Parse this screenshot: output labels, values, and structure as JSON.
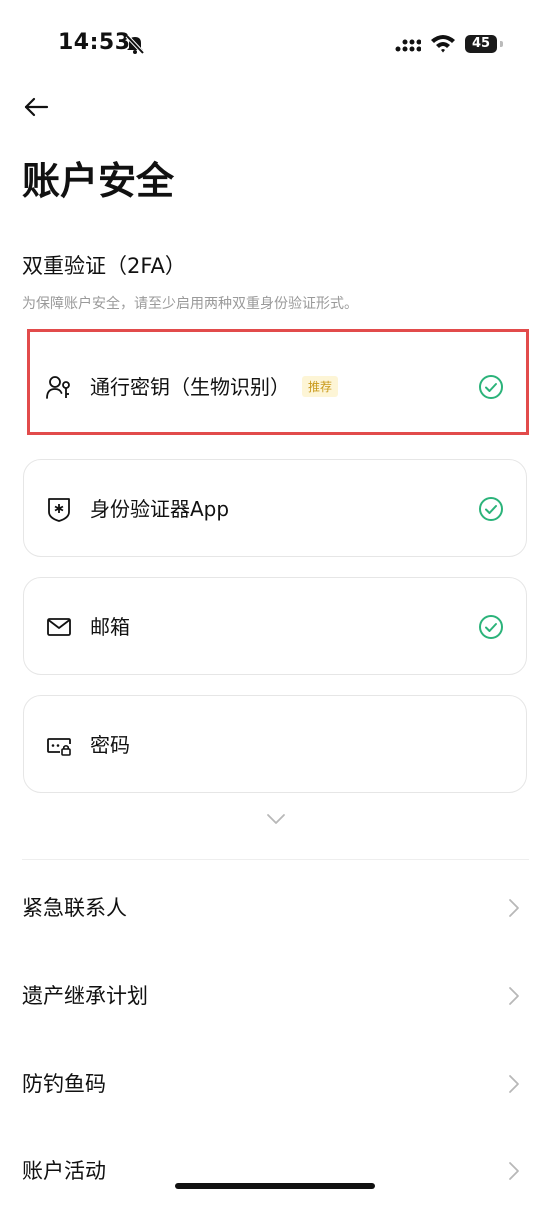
{
  "status_bar": {
    "time": "14:53",
    "battery": "45"
  },
  "page": {
    "title": "账户安全"
  },
  "twofa": {
    "title": "双重验证（2FA）",
    "description": "为保障账户安全，请至少启用两种双重身份验证形式。",
    "methods": [
      {
        "label": "通行密钥（生物识别）",
        "tag": "推荐",
        "icon": "passkey-icon",
        "enabled": true
      },
      {
        "label": "身份验证器App",
        "icon": "authenticator-shield-icon",
        "enabled": true
      },
      {
        "label": "邮箱",
        "icon": "mail-icon",
        "enabled": true
      },
      {
        "label": "密码",
        "icon": "password-icon",
        "enabled": false
      }
    ]
  },
  "settings": [
    {
      "label": "紧急联系人"
    },
    {
      "label": "遗产继承计划"
    },
    {
      "label": "防钓鱼码"
    },
    {
      "label": "账户活动"
    }
  ],
  "colors": {
    "check": "#2bb37a",
    "highlight": "#e24b4b",
    "tag_bg": "#fdf5d6",
    "tag_text": "#c99a1b"
  }
}
